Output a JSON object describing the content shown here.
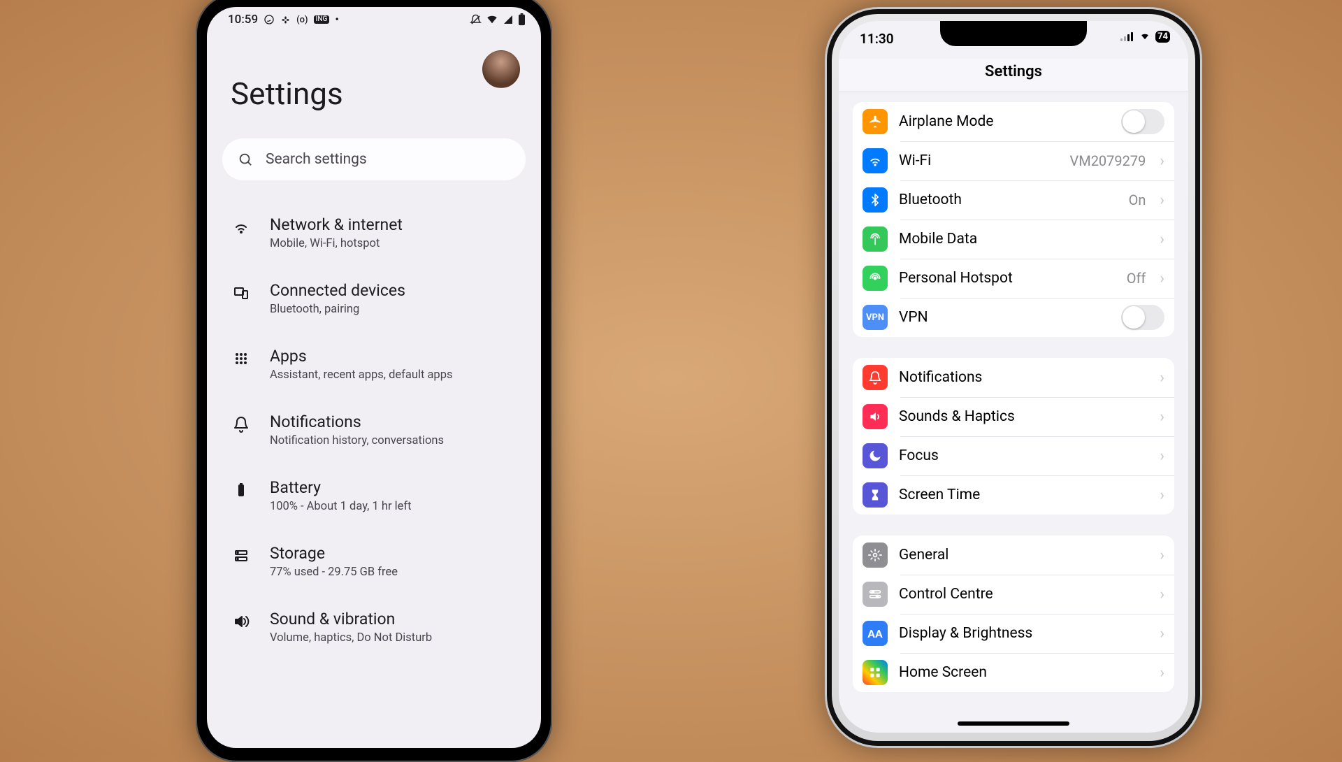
{
  "android": {
    "status": {
      "time": "10:59",
      "left_icons": [
        "whatsapp-icon",
        "slack-icon",
        "recording-icon",
        "app-badge-icon",
        "dot-icon"
      ],
      "right_icons": [
        "dnd-icon",
        "wifi-icon",
        "signal-icon",
        "battery-icon"
      ]
    },
    "title": "Settings",
    "search_placeholder": "Search settings",
    "items": [
      {
        "icon": "wifi-icon",
        "title": "Network & internet",
        "sub": "Mobile, Wi-Fi, hotspot"
      },
      {
        "icon": "devices-icon",
        "title": "Connected devices",
        "sub": "Bluetooth, pairing"
      },
      {
        "icon": "apps-grid-icon",
        "title": "Apps",
        "sub": "Assistant, recent apps, default apps"
      },
      {
        "icon": "bell-icon",
        "title": "Notifications",
        "sub": "Notification history, conversations"
      },
      {
        "icon": "battery-icon",
        "title": "Battery",
        "sub": "100% - About 1 day, 1 hr left"
      },
      {
        "icon": "storage-icon",
        "title": "Storage",
        "sub": "77% used - 29.75 GB free"
      },
      {
        "icon": "volume-icon",
        "title": "Sound & vibration",
        "sub": "Volume, haptics, Do Not Disturb"
      }
    ]
  },
  "ios": {
    "status": {
      "time": "11:30",
      "battery": "74"
    },
    "title": "Settings",
    "groups": [
      [
        {
          "icon": "airplane-icon",
          "bg": "bg-orange",
          "label": "Airplane Mode",
          "control": "toggle"
        },
        {
          "icon": "wifi-icon",
          "bg": "bg-blue",
          "label": "Wi-Fi",
          "value": "VM2079279",
          "control": "disclosure"
        },
        {
          "icon": "bluetooth-icon",
          "bg": "bg-blue",
          "label": "Bluetooth",
          "value": "On",
          "control": "disclosure"
        },
        {
          "icon": "antenna-icon",
          "bg": "bg-green",
          "label": "Mobile Data",
          "control": "disclosure"
        },
        {
          "icon": "hotspot-icon",
          "bg": "bg-green2",
          "label": "Personal Hotspot",
          "value": "Off",
          "control": "disclosure"
        },
        {
          "icon": "vpn-icon",
          "bg": "bg-bluev",
          "label": "VPN",
          "control": "toggle"
        }
      ],
      [
        {
          "icon": "bell-icon",
          "bg": "bg-red",
          "label": "Notifications",
          "control": "disclosure"
        },
        {
          "icon": "speaker-icon",
          "bg": "bg-red2",
          "label": "Sounds & Haptics",
          "control": "disclosure"
        },
        {
          "icon": "moon-icon",
          "bg": "bg-indigo",
          "label": "Focus",
          "control": "disclosure"
        },
        {
          "icon": "hourglass-icon",
          "bg": "bg-indigo",
          "label": "Screen Time",
          "control": "disclosure"
        }
      ],
      [
        {
          "icon": "gear-icon",
          "bg": "bg-gray",
          "label": "General",
          "control": "disclosure"
        },
        {
          "icon": "switches-icon",
          "bg": "bg-gray2",
          "label": "Control Centre",
          "control": "disclosure"
        },
        {
          "icon": "aa-icon",
          "bg": "bg-blue2",
          "label": "Display & Brightness",
          "control": "disclosure"
        },
        {
          "icon": "grid-icon",
          "bg": "bg-multi",
          "label": "Home Screen",
          "control": "disclosure"
        }
      ]
    ]
  }
}
